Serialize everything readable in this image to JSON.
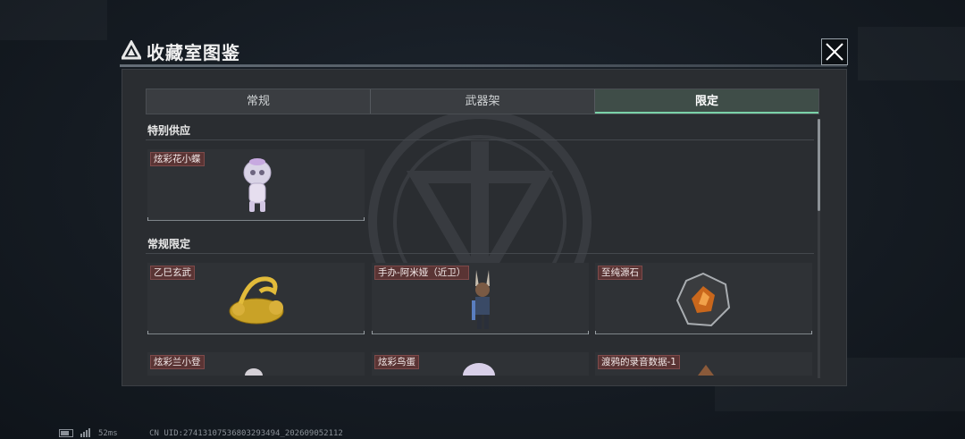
{
  "window": {
    "title": "收藏室图鉴"
  },
  "tabs": [
    {
      "label": "常规",
      "active": false
    },
    {
      "label": "武器架",
      "active": false
    },
    {
      "label": "限定",
      "active": true
    }
  ],
  "sections": [
    {
      "title": "特别供应",
      "items": [
        {
          "name": "炫彩花小蝶",
          "icon": "mascot-figure-icon"
        }
      ]
    },
    {
      "title": "常规限定",
      "items": [
        {
          "name": "乙巳玄武",
          "icon": "golden-dragon-icon"
        },
        {
          "name": "手办-阿米娅（近卫）",
          "icon": "amiya-figure-icon"
        },
        {
          "name": "至纯源石",
          "icon": "originium-crystal-icon"
        },
        {
          "name": "炫彩兰小登",
          "icon": "figure-icon"
        },
        {
          "name": "炫彩鸟蛋",
          "icon": "egg-icon"
        },
        {
          "name": "渡鸦的录音数据-1",
          "icon": "recorder-icon"
        }
      ]
    }
  ],
  "status": {
    "ping": "52ms",
    "uid": "CN UID:274131075368032934​94_202609052112"
  },
  "colors": {
    "accent": "#7ad2a8",
    "label_bg": "#5a3434",
    "panel_bg": "#2a2d31"
  }
}
